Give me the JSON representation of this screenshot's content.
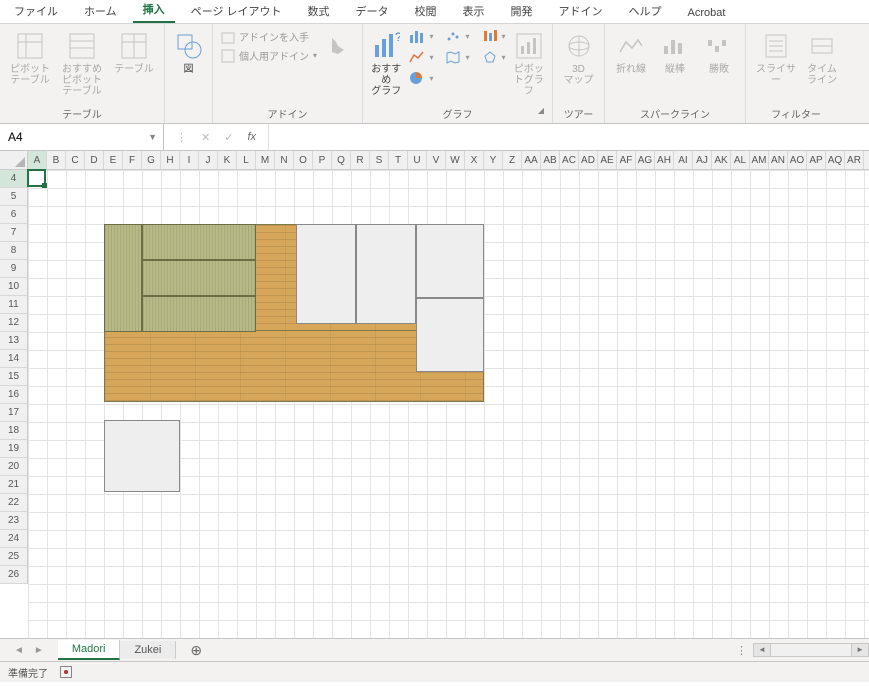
{
  "tabs": [
    "ファイル",
    "ホーム",
    "挿入",
    "ページ レイアウト",
    "数式",
    "データ",
    "校閲",
    "表示",
    "開発",
    "アドイン",
    "ヘルプ",
    "Acrobat"
  ],
  "active_tab_index": 2,
  "ribbon_groups": {
    "tables": {
      "label": "テーブル",
      "pivot": "ピボット\nテーブル",
      "recommend_pivot": "おすすめ\nピボットテーブル",
      "table": "テーブル"
    },
    "illust": {
      "label": "",
      "shapes": "図"
    },
    "addins": {
      "label": "アドイン",
      "get": "アドインを入手",
      "personal": "個人用アドイン",
      "bing": ""
    },
    "charts": {
      "label": "グラフ",
      "recommended": "おすすめ\nグラフ",
      "pivotchart": "ピボットグラフ"
    },
    "tours": {
      "label": "ツアー",
      "map": "3D\nマップ"
    },
    "sparklines": {
      "label": "スパークライン",
      "line": "折れ線",
      "column": "縦棒",
      "winloss": "勝敗"
    },
    "filters": {
      "label": "フィルター",
      "slicer": "スライサー",
      "timeline": "タイム\nライン"
    }
  },
  "namebox_value": "A4",
  "formula_value": "",
  "columns": [
    "A",
    "B",
    "C",
    "D",
    "E",
    "F",
    "G",
    "H",
    "I",
    "J",
    "K",
    "L",
    "M",
    "N",
    "O",
    "P",
    "Q",
    "R",
    "S",
    "T",
    "U",
    "V",
    "W",
    "X",
    "Y",
    "Z",
    "AA",
    "AB",
    "AC",
    "AD",
    "AE",
    "AF",
    "AG",
    "AH",
    "AI",
    "AJ",
    "AK",
    "AL",
    "AM",
    "AN",
    "AO",
    "AP",
    "AQ",
    "AR"
  ],
  "rows": [
    4,
    5,
    6,
    7,
    8,
    9,
    10,
    11,
    12,
    13,
    14,
    15,
    16,
    17,
    18,
    19,
    20,
    21,
    22,
    23,
    24,
    25,
    26
  ],
  "active_cell": "A4",
  "sheet_tabs": [
    "Madori",
    "Zukei"
  ],
  "active_sheet_index": 0,
  "status_text": "準備完了"
}
